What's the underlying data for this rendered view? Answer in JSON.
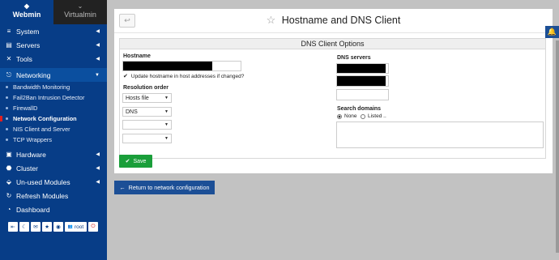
{
  "sidebar": {
    "tabs": [
      {
        "label": "Webmin",
        "glyph": "◆"
      },
      {
        "label": "Virtualmin",
        "glyph": "⌄"
      }
    ],
    "items": [
      {
        "label": "System",
        "icon": "≡",
        "caret": "◀"
      },
      {
        "label": "Servers",
        "icon": "▤",
        "caret": "◀"
      },
      {
        "label": "Tools",
        "icon": "✕",
        "caret": "◀"
      },
      {
        "label": "Networking",
        "icon": "⎋",
        "caret": "▼"
      },
      {
        "label": "Hardware",
        "icon": "▣",
        "caret": "◀"
      },
      {
        "label": "Cluster",
        "icon": "⬣",
        "caret": "◀"
      },
      {
        "label": "Un-used Modules",
        "icon": "⬙",
        "caret": "◀"
      },
      {
        "label": "Refresh Modules",
        "icon": "↻"
      },
      {
        "label": "Dashboard",
        "icon": "◔"
      }
    ],
    "subitems": [
      "Bandwidth Monitoring",
      "Fail2Ban Intrusion Detector",
      "FirewallD",
      "Network Configuration",
      "NIS Client and Server",
      "TCP Wrappers"
    ],
    "toolbar": {
      "b1": "⇤",
      "b2": "☾",
      "b3": "✉",
      "b4": "★",
      "b5": "◉",
      "user": "root",
      "user_icon": "👥",
      "logout": "⏻"
    }
  },
  "page": {
    "back": "↩",
    "star": "☆",
    "title": "Hostname and DNS Client"
  },
  "form": {
    "section_title": "DNS Client Options",
    "hostname_label": "Hostname",
    "update_hosts_label": "Update hostname in host addresses if changed?",
    "resolution_label": "Resolution order",
    "resolution": [
      "Hosts file",
      "DNS",
      "",
      ""
    ],
    "dns_servers_label": "DNS servers",
    "search_domains_label": "Search domains",
    "search_none": "None",
    "search_listed": "Listed ..",
    "save": "Save",
    "save_icon": "✔"
  },
  "return": {
    "label": "Return to network configuration",
    "icon": "←"
  },
  "bell": "🔔"
}
